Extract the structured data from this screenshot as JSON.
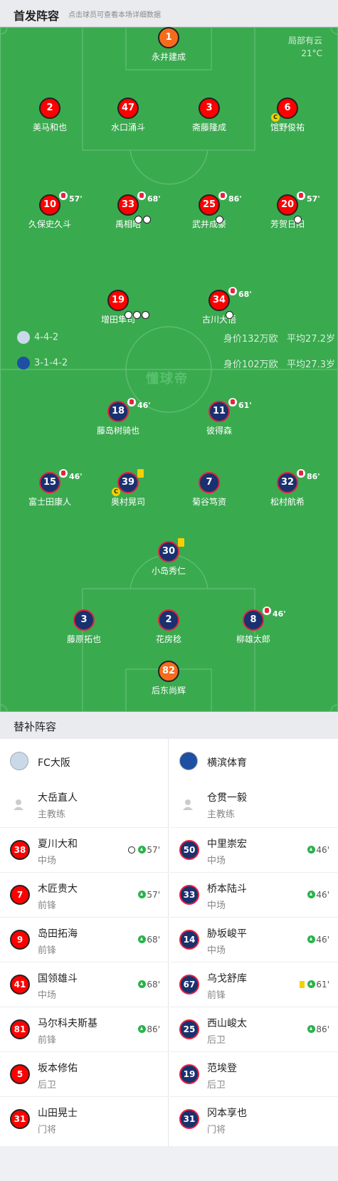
{
  "header": {
    "title": "首发阵容",
    "subtitle": "点击球员可查看本场详细数据"
  },
  "weather": {
    "condition": "局部有云",
    "temp": "21°C"
  },
  "watermark": "懂球帝",
  "home": {
    "formation": "4-4-2",
    "value": "身价132万欧",
    "avg_age": "平均27.2岁",
    "players": [
      {
        "num": "1",
        "name": "永井建成"
      },
      {
        "num": "2",
        "name": "美马和也"
      },
      {
        "num": "47",
        "name": "水口涌斗"
      },
      {
        "num": "3",
        "name": "斋藤隆成",
        "card": "yellow"
      },
      {
        "num": "6",
        "name": "馆野俊祐",
        "captain": "C"
      },
      {
        "num": "10",
        "name": "久保史久斗",
        "sub_min": "57'"
      },
      {
        "num": "33",
        "name": "禹相皓",
        "sub_min": "68'"
      },
      {
        "num": "25",
        "name": "武井成豪",
        "sub_min": "86'"
      },
      {
        "num": "20",
        "name": "芳贺日阳",
        "sub_min": "57'"
      },
      {
        "num": "19",
        "name": "增田隼司"
      },
      {
        "num": "34",
        "name": "古川大悟",
        "sub_min": "68'"
      }
    ]
  },
  "away": {
    "formation": "3-1-4-2",
    "value": "身价102万欧",
    "avg_age": "平均27.3岁",
    "players": [
      {
        "num": "18",
        "name": "藤岛树骑也",
        "sub_min": "46'"
      },
      {
        "num": "11",
        "name": "彼得森",
        "sub_min": "61'"
      },
      {
        "num": "15",
        "name": "富士田康人",
        "sub_min": "46'"
      },
      {
        "num": "39",
        "name": "奥村晃司",
        "card": "yellow",
        "captain": "C"
      },
      {
        "num": "7",
        "name": "菊谷笃资"
      },
      {
        "num": "32",
        "name": "松村航希",
        "sub_min": "86'"
      },
      {
        "num": "30",
        "name": "小岛秀仁",
        "card": "yellow"
      },
      {
        "num": "3",
        "name": "藤原拓也"
      },
      {
        "num": "2",
        "name": "花房稔"
      },
      {
        "num": "8",
        "name": "柳雄太郎",
        "sub_min": "46'"
      },
      {
        "num": "82",
        "name": "后东尚辉"
      }
    ]
  },
  "subs_section": {
    "title": "替补阵容"
  },
  "subs_home": {
    "team": "FC大阪",
    "coach": {
      "name": "大岳直人",
      "role": "主教练"
    },
    "players": [
      {
        "num": "38",
        "name": "夏川大和",
        "pos": "中场",
        "min": "57'"
      },
      {
        "num": "7",
        "name": "木匠贵大",
        "pos": "前锋",
        "min": "57'"
      },
      {
        "num": "9",
        "name": "岛田拓海",
        "pos": "前锋",
        "min": "68'"
      },
      {
        "num": "41",
        "name": "国领雄斗",
        "pos": "中场",
        "min": "68'"
      },
      {
        "num": "81",
        "name": "马尔科夫斯基",
        "pos": "前锋",
        "min": "86'"
      },
      {
        "num": "5",
        "name": "坂本修佑",
        "pos": "后卫",
        "min": ""
      },
      {
        "num": "31",
        "name": "山田晃士",
        "pos": "门将",
        "min": ""
      }
    ]
  },
  "subs_away": {
    "team": "横滨体育",
    "coach": {
      "name": "仓贯一毅",
      "role": "主教练"
    },
    "players": [
      {
        "num": "50",
        "name": "中里崇宏",
        "pos": "中场",
        "min": "46'"
      },
      {
        "num": "33",
        "name": "桥本陆斗",
        "pos": "中场",
        "min": "46'"
      },
      {
        "num": "14",
        "name": "胁坂峻平",
        "pos": "中场",
        "min": "46'"
      },
      {
        "num": "67",
        "name": "乌戈舒库",
        "pos": "前锋",
        "min": "61'"
      },
      {
        "num": "25",
        "name": "西山峻太",
        "pos": "后卫",
        "min": "86'"
      },
      {
        "num": "19",
        "name": "范埃登",
        "pos": "后卫",
        "min": ""
      },
      {
        "num": "31",
        "name": "冈本享也",
        "pos": "门将",
        "min": ""
      }
    ]
  },
  "colors": {
    "pitch": "#3aaa4f",
    "home": "#ff0000",
    "away": "#19316f",
    "keeper": "#f76b1c"
  }
}
